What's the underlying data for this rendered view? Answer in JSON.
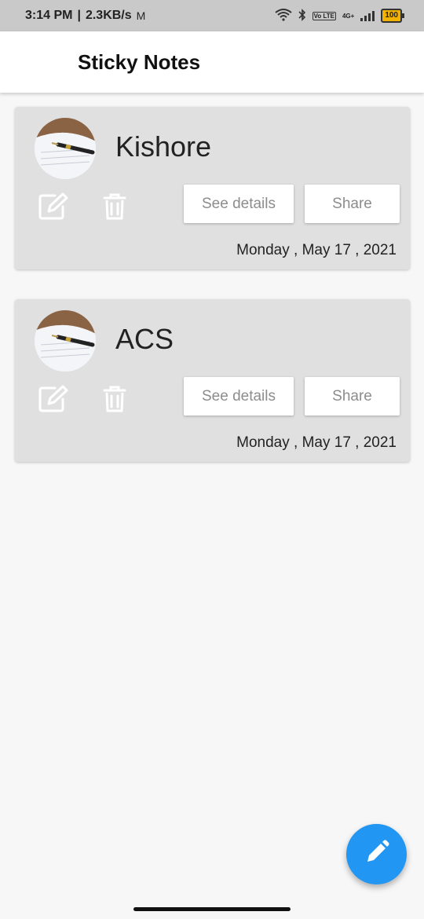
{
  "status_bar": {
    "time": "3:14 PM",
    "network_speed": "2.3KB/s",
    "mail_icon": "gmail-icon",
    "volte_badge": "Vo LTE",
    "network_type": "4G+",
    "battery": "100"
  },
  "app_bar": {
    "title": "Sticky Notes"
  },
  "notes": [
    {
      "title": "Kishore",
      "avatar_icon": "pen-on-paper-image",
      "see_details_label": "See details",
      "share_label": "Share",
      "date": "Monday , May 17 , 2021"
    },
    {
      "title": "ACS",
      "avatar_icon": "pen-on-paper-image",
      "see_details_label": "See details",
      "share_label": "Share",
      "date": "Monday , May 17 , 2021"
    }
  ],
  "fab": {
    "icon": "pencil-icon",
    "color": "#2196f3"
  },
  "colors": {
    "card_background": "#e0e0e0",
    "page_background": "#f7f7f7",
    "accent": "#2196f3"
  }
}
